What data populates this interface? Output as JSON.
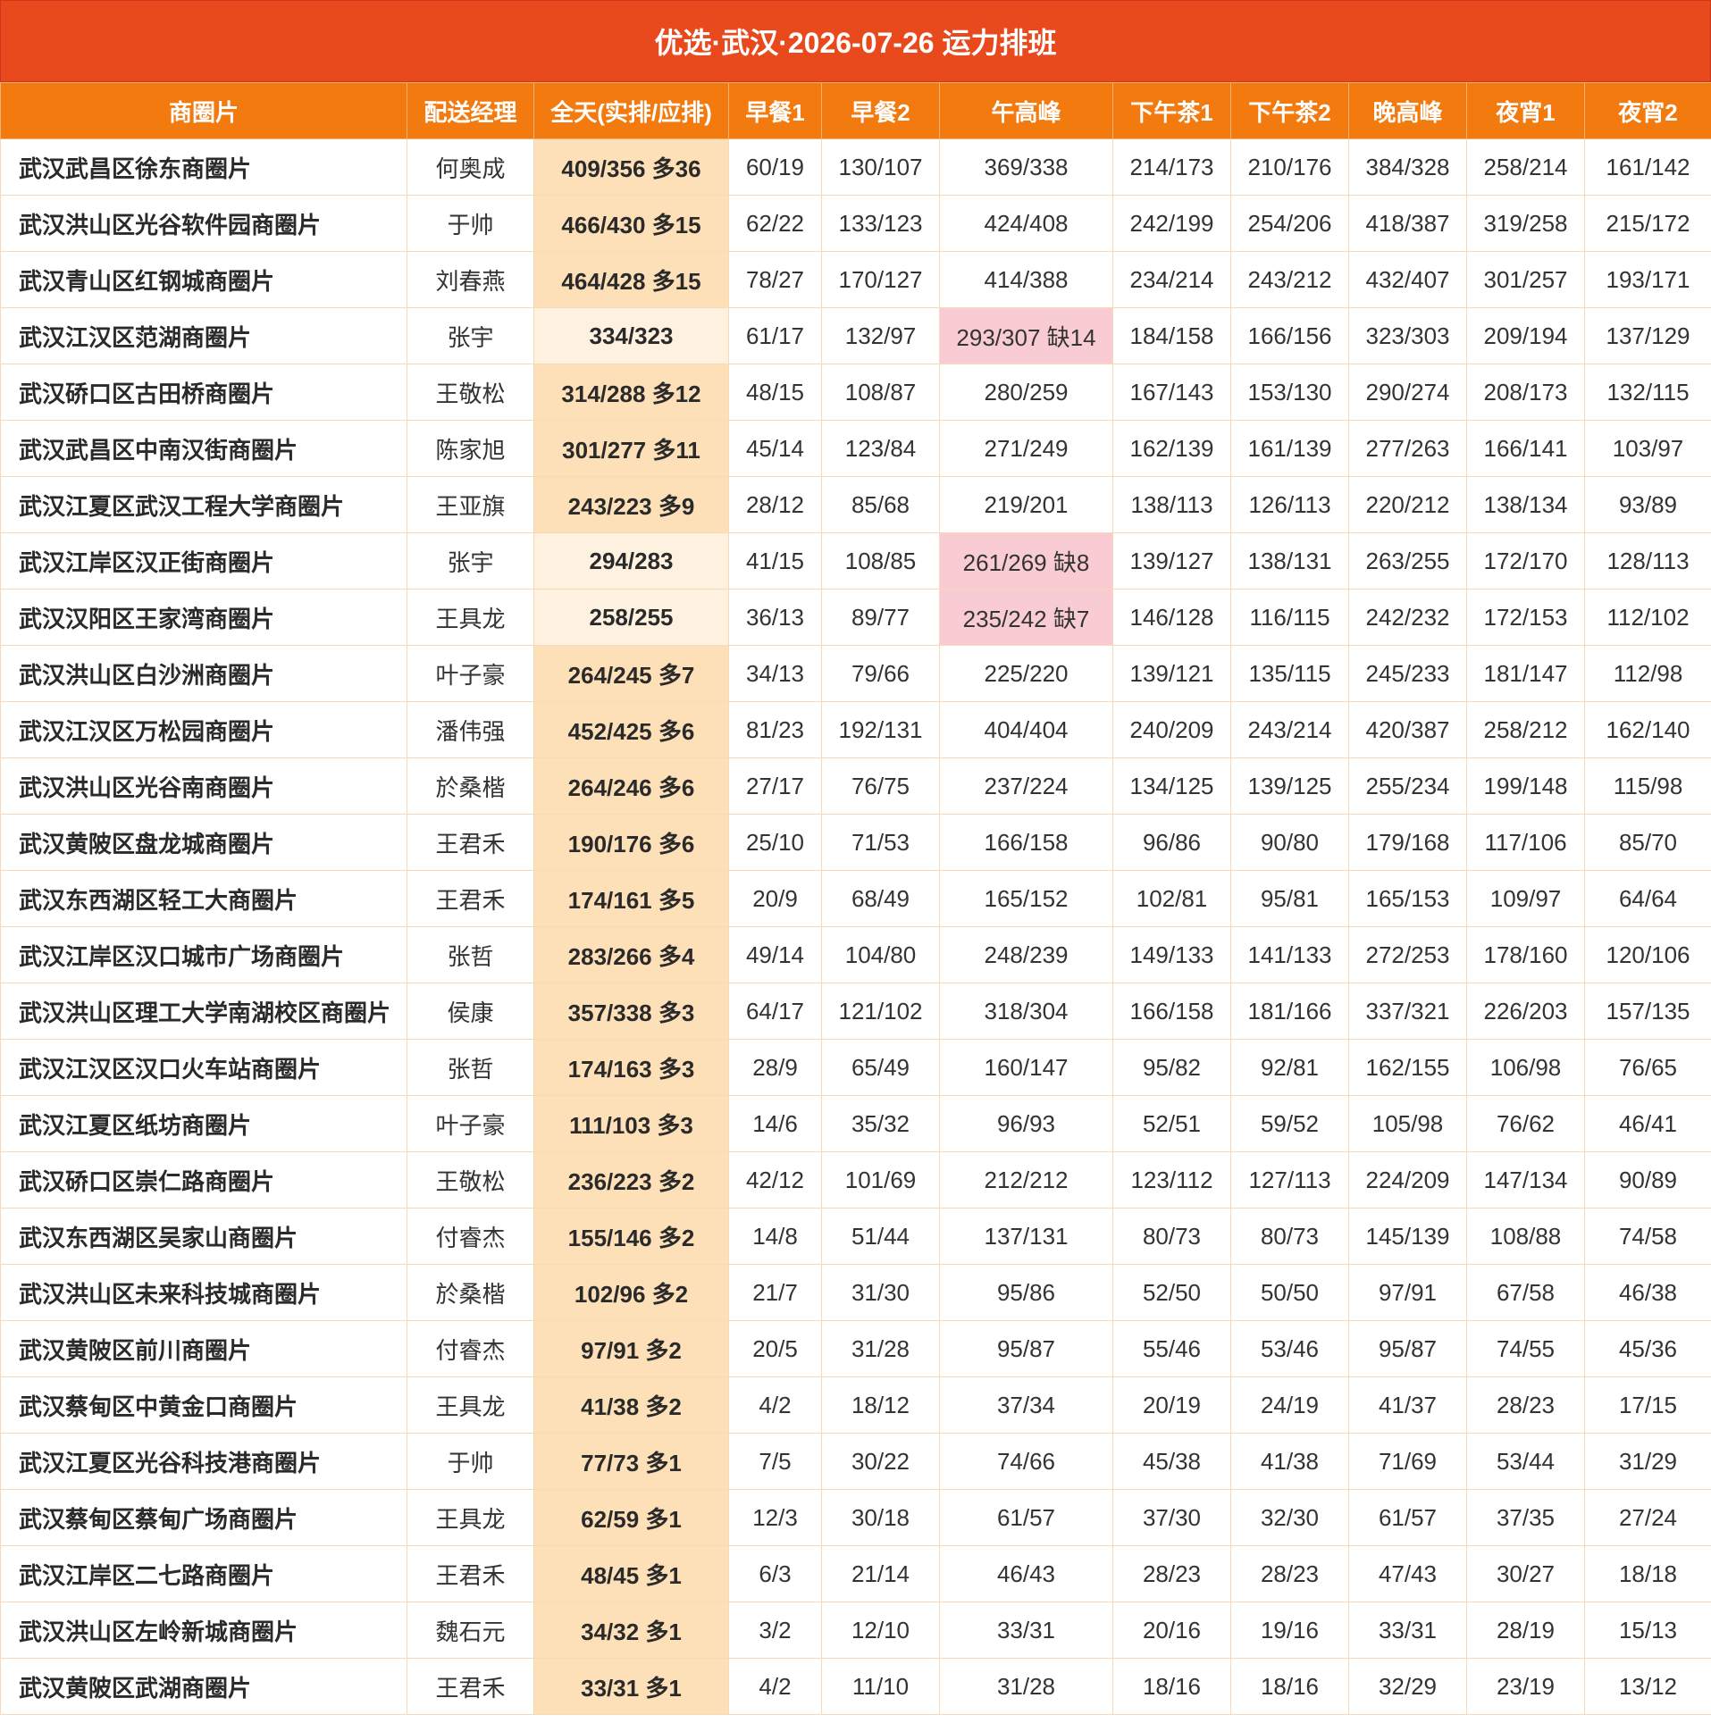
{
  "title": "优选·武汉·2026-07-26 运力排班",
  "headers": [
    "商圈片",
    "配送经理",
    "全天(实排/应排)",
    "早餐1",
    "早餐2",
    "午高峰",
    "下午茶1",
    "下午茶2",
    "晚高峰",
    "夜宵1",
    "夜宵2"
  ],
  "colors": {
    "title_bg": "#e8491d",
    "header_bg": "#f27a0f",
    "total_bg": "#fde0b8",
    "short_bg": "#f9ccd3"
  },
  "rows": [
    {
      "zone": "武汉武昌区徐东商圈片",
      "manager": "何奥成",
      "total": "409/356 多36",
      "slots": [
        "60/19",
        "130/107",
        "369/338",
        "214/173",
        "210/176",
        "384/328",
        "258/214",
        "161/142"
      ]
    },
    {
      "zone": "武汉洪山区光谷软件园商圈片",
      "manager": "于帅",
      "total": "466/430 多15",
      "slots": [
        "62/22",
        "133/123",
        "424/408",
        "242/199",
        "254/206",
        "418/387",
        "319/258",
        "215/172"
      ]
    },
    {
      "zone": "武汉青山区红钢城商圈片",
      "manager": "刘春燕",
      "total": "464/428 多15",
      "slots": [
        "78/27",
        "170/127",
        "414/388",
        "234/214",
        "243/212",
        "432/407",
        "301/257",
        "193/171"
      ]
    },
    {
      "zone": "武汉江汉区范湖商圈片",
      "manager": "张宇",
      "total": "334/323",
      "slots": [
        "61/17",
        "132/97",
        "293/307 缺14",
        "184/158",
        "166/156",
        "323/303",
        "209/194",
        "137/129"
      ]
    },
    {
      "zone": "武汉硚口区古田桥商圈片",
      "manager": "王敬松",
      "total": "314/288 多12",
      "slots": [
        "48/15",
        "108/87",
        "280/259",
        "167/143",
        "153/130",
        "290/274",
        "208/173",
        "132/115"
      ]
    },
    {
      "zone": "武汉武昌区中南汉街商圈片",
      "manager": "陈家旭",
      "total": "301/277 多11",
      "slots": [
        "45/14",
        "123/84",
        "271/249",
        "162/139",
        "161/139",
        "277/263",
        "166/141",
        "103/97"
      ]
    },
    {
      "zone": "武汉江夏区武汉工程大学商圈片",
      "manager": "王亚旗",
      "total": "243/223 多9",
      "slots": [
        "28/12",
        "85/68",
        "219/201",
        "138/113",
        "126/113",
        "220/212",
        "138/134",
        "93/89"
      ]
    },
    {
      "zone": "武汉江岸区汉正街商圈片",
      "manager": "张宇",
      "total": "294/283",
      "slots": [
        "41/15",
        "108/85",
        "261/269 缺8",
        "139/127",
        "138/131",
        "263/255",
        "172/170",
        "128/113"
      ]
    },
    {
      "zone": "武汉汉阳区王家湾商圈片",
      "manager": "王具龙",
      "total": "258/255",
      "slots": [
        "36/13",
        "89/77",
        "235/242 缺7",
        "146/128",
        "116/115",
        "242/232",
        "172/153",
        "112/102"
      ]
    },
    {
      "zone": "武汉洪山区白沙洲商圈片",
      "manager": "叶子豪",
      "total": "264/245 多7",
      "slots": [
        "34/13",
        "79/66",
        "225/220",
        "139/121",
        "135/115",
        "245/233",
        "181/147",
        "112/98"
      ]
    },
    {
      "zone": "武汉江汉区万松园商圈片",
      "manager": "潘伟强",
      "total": "452/425 多6",
      "slots": [
        "81/23",
        "192/131",
        "404/404",
        "240/209",
        "243/214",
        "420/387",
        "258/212",
        "162/140"
      ]
    },
    {
      "zone": "武汉洪山区光谷南商圈片",
      "manager": "於桑楷",
      "total": "264/246 多6",
      "slots": [
        "27/17",
        "76/75",
        "237/224",
        "134/125",
        "139/125",
        "255/234",
        "199/148",
        "115/98"
      ]
    },
    {
      "zone": "武汉黄陂区盘龙城商圈片",
      "manager": "王君禾",
      "total": "190/176 多6",
      "slots": [
        "25/10",
        "71/53",
        "166/158",
        "96/86",
        "90/80",
        "179/168",
        "117/106",
        "85/70"
      ]
    },
    {
      "zone": "武汉东西湖区轻工大商圈片",
      "manager": "王君禾",
      "total": "174/161 多5",
      "slots": [
        "20/9",
        "68/49",
        "165/152",
        "102/81",
        "95/81",
        "165/153",
        "109/97",
        "64/64"
      ]
    },
    {
      "zone": "武汉江岸区汉口城市广场商圈片",
      "manager": "张哲",
      "total": "283/266 多4",
      "slots": [
        "49/14",
        "104/80",
        "248/239",
        "149/133",
        "141/133",
        "272/253",
        "178/160",
        "120/106"
      ]
    },
    {
      "zone": "武汉洪山区理工大学南湖校区商圈片",
      "manager": "侯康",
      "total": "357/338 多3",
      "slots": [
        "64/17",
        "121/102",
        "318/304",
        "166/158",
        "181/166",
        "337/321",
        "226/203",
        "157/135"
      ]
    },
    {
      "zone": "武汉江汉区汉口火车站商圈片",
      "manager": "张哲",
      "total": "174/163 多3",
      "slots": [
        "28/9",
        "65/49",
        "160/147",
        "95/82",
        "92/81",
        "162/155",
        "106/98",
        "76/65"
      ]
    },
    {
      "zone": "武汉江夏区纸坊商圈片",
      "manager": "叶子豪",
      "total": "111/103 多3",
      "slots": [
        "14/6",
        "35/32",
        "96/93",
        "52/51",
        "59/52",
        "105/98",
        "76/62",
        "46/41"
      ]
    },
    {
      "zone": "武汉硚口区崇仁路商圈片",
      "manager": "王敬松",
      "total": "236/223 多2",
      "slots": [
        "42/12",
        "101/69",
        "212/212",
        "123/112",
        "127/113",
        "224/209",
        "147/134",
        "90/89"
      ]
    },
    {
      "zone": "武汉东西湖区吴家山商圈片",
      "manager": "付睿杰",
      "total": "155/146 多2",
      "slots": [
        "14/8",
        "51/44",
        "137/131",
        "80/73",
        "80/73",
        "145/139",
        "108/88",
        "74/58"
      ]
    },
    {
      "zone": "武汉洪山区未来科技城商圈片",
      "manager": "於桑楷",
      "total": "102/96 多2",
      "slots": [
        "21/7",
        "31/30",
        "95/86",
        "52/50",
        "50/50",
        "97/91",
        "67/58",
        "46/38"
      ]
    },
    {
      "zone": "武汉黄陂区前川商圈片",
      "manager": "付睿杰",
      "total": "97/91 多2",
      "slots": [
        "20/5",
        "31/28",
        "95/87",
        "55/46",
        "53/46",
        "95/87",
        "74/55",
        "45/36"
      ]
    },
    {
      "zone": "武汉蔡甸区中黄金口商圈片",
      "manager": "王具龙",
      "total": "41/38 多2",
      "slots": [
        "4/2",
        "18/12",
        "37/34",
        "20/19",
        "24/19",
        "41/37",
        "28/23",
        "17/15"
      ]
    },
    {
      "zone": "武汉江夏区光谷科技港商圈片",
      "manager": "于帅",
      "total": "77/73 多1",
      "slots": [
        "7/5",
        "30/22",
        "74/66",
        "45/38",
        "41/38",
        "71/69",
        "53/44",
        "31/29"
      ]
    },
    {
      "zone": "武汉蔡甸区蔡甸广场商圈片",
      "manager": "王具龙",
      "total": "62/59 多1",
      "slots": [
        "12/3",
        "30/18",
        "61/57",
        "37/30",
        "32/30",
        "61/57",
        "37/35",
        "27/24"
      ]
    },
    {
      "zone": "武汉江岸区二七路商圈片",
      "manager": "王君禾",
      "total": "48/45 多1",
      "slots": [
        "6/3",
        "21/14",
        "46/43",
        "28/23",
        "28/23",
        "47/43",
        "30/27",
        "18/18"
      ]
    },
    {
      "zone": "武汉洪山区左岭新城商圈片",
      "manager": "魏石元",
      "total": "34/32 多1",
      "slots": [
        "3/2",
        "12/10",
        "33/31",
        "20/16",
        "19/16",
        "33/31",
        "28/19",
        "15/13"
      ]
    },
    {
      "zone": "武汉黄陂区武湖商圈片",
      "manager": "王君禾",
      "total": "33/31 多1",
      "slots": [
        "4/2",
        "11/10",
        "31/28",
        "18/16",
        "18/16",
        "32/29",
        "23/19",
        "13/12"
      ]
    }
  ]
}
